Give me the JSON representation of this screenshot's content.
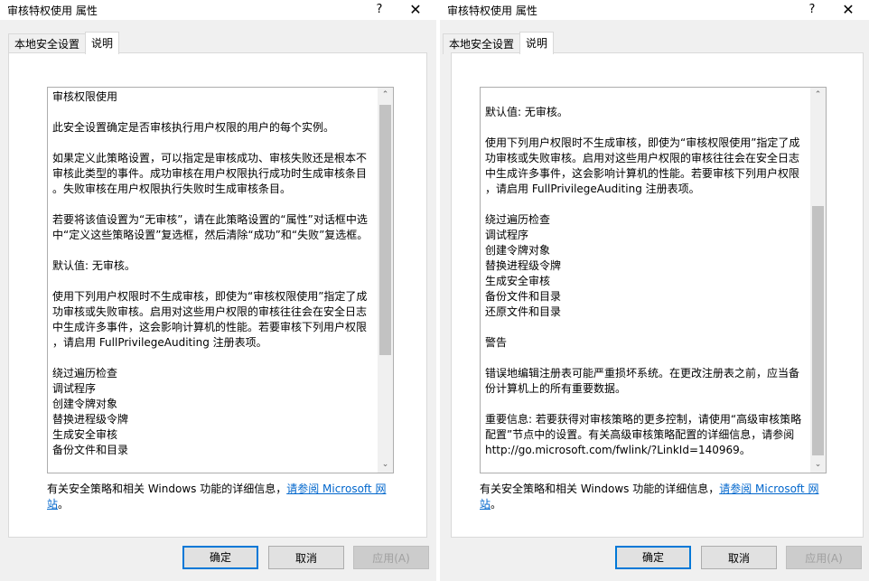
{
  "window_title": "审核特权使用 属性",
  "tabs": [
    "本地安全设置",
    "说明"
  ],
  "left_text": [
    "审核权限使用",
    "",
    "此安全设置确定是否审核执行用户权限的用户的每个实例。",
    "",
    "如果定义此策略设置，可以指定是审核成功、审核失败还是根本不",
    "审核此类型的事件。成功审核在用户权限执行成功时生成审核条目",
    "。失败审核在用户权限执行失败时生成审核条目。",
    "",
    "若要将该值设置为“无审核”，请在此策略设置的“属性”对话框中选",
    "中“定义这些策略设置”复选框，然后清除“成功”和“失败”复选框。",
    "",
    "默认值: 无审核。",
    "",
    "使用下列用户权限时不生成审核，即使为“审核权限使用”指定了成",
    "功审核或失败审核。启用对这些用户权限的审核往往会在安全日志",
    "中生成许多事件，这会影响计算机的性能。若要审核下列用户权限",
    "，请启用 FullPrivilegeAuditing 注册表项。",
    "",
    "绕过遍历检查",
    "调试程序",
    "创建令牌对象",
    "替换进程级令牌",
    "生成安全审核",
    "备份文件和目录"
  ],
  "right_text": [
    "默认值: 无审核。",
    "",
    "使用下列用户权限时不生成审核，即使为“审核权限使用”指定了成",
    "功审核或失败审核。启用对这些用户权限的审核往往会在安全日志",
    "中生成许多事件，这会影响计算机的性能。若要审核下列用户权限",
    "，请启用 FullPrivilegeAuditing 注册表项。",
    "",
    "绕过遍历检查",
    "调试程序",
    "创建令牌对象",
    "替换进程级令牌",
    "生成安全审核",
    "备份文件和目录",
    "还原文件和目录",
    "",
    "警告",
    "",
    "错误地编辑注册表可能严重损坏系统。在更改注册表之前，应当备",
    "份计算机上的所有重要数据。",
    "",
    "重要信息: 若要获得对审核策略的更多控制，请使用“高级审核策略",
    "配置”节点中的设置。有关高级审核策略配置的详细信息，请参阅",
    "http://go.microsoft.com/fwlink/?LinkId=140969。"
  ],
  "footer": {
    "text": "有关安全策略和相关 Windows 功能的详细信息，",
    "link_line1": "请参阅 Microsoft 网",
    "link_line2": "站",
    "period": "。"
  },
  "buttons": {
    "ok": "确定",
    "cancel": "取消",
    "apply": "应用(A)"
  },
  "titlebar_buttons": {
    "help": "?",
    "close": "✕"
  },
  "scroll_arrows": {
    "up": "⌃",
    "down": "⌄"
  }
}
